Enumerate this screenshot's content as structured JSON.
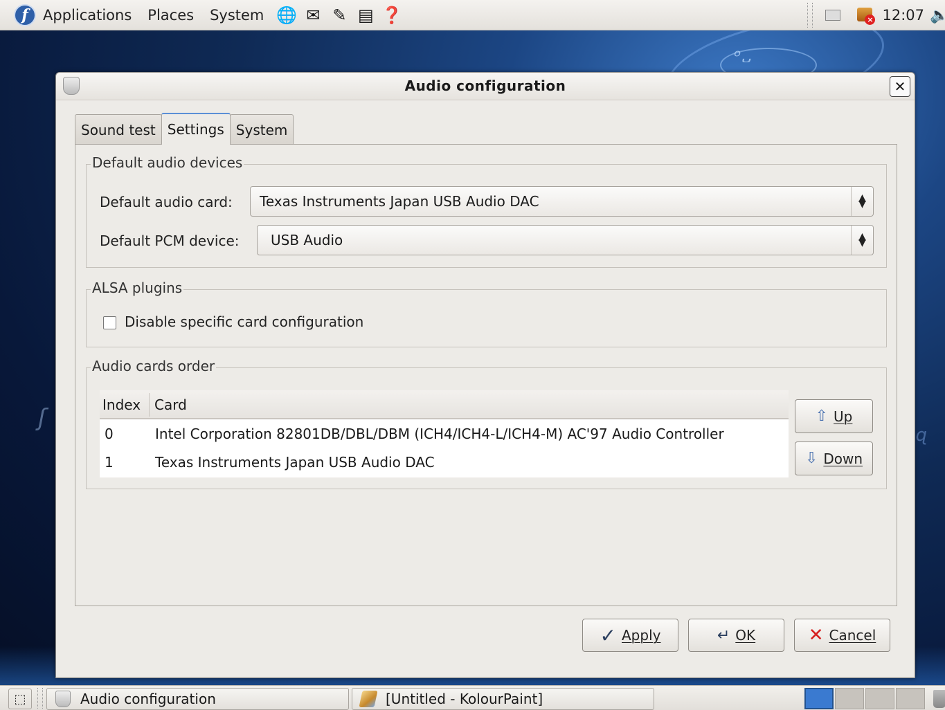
{
  "top_panel": {
    "menus": [
      "Applications",
      "Places",
      "System"
    ],
    "launcher_icons": [
      "web-browser-icon",
      "mail-client-icon",
      "text-editor-icon",
      "office-icon",
      "help-icon"
    ],
    "clock": "12:07"
  },
  "dialog": {
    "title": "Audio configuration",
    "tabs": [
      {
        "label": "Sound test",
        "active": false
      },
      {
        "label": "Settings",
        "active": true
      },
      {
        "label": "System",
        "active": false
      }
    ],
    "default_devices": {
      "legend": "Default audio devices",
      "card_label": "Default audio card:",
      "card_value": "Texas Instruments Japan USB Audio DAC",
      "pcm_label": "Default PCM device:",
      "pcm_value": "USB Audio"
    },
    "alsa_plugins": {
      "legend": "ALSA plugins",
      "checkbox_label": "Disable specific card configuration",
      "checked": false
    },
    "cards_order": {
      "legend": "Audio cards order",
      "columns": [
        "Index",
        "Card"
      ],
      "rows": [
        {
          "index": "0",
          "card": "Intel Corporation 82801DB/DBL/DBM (ICH4/ICH4-L/ICH4-M) AC'97 Audio Controller"
        },
        {
          "index": "1",
          "card": "Texas Instruments Japan USB Audio DAC"
        }
      ],
      "up_label": "Up",
      "down_label": "Down"
    },
    "buttons": {
      "apply": "Apply",
      "ok": "OK",
      "cancel": "Cancel"
    }
  },
  "taskbar": {
    "tasks": [
      {
        "label": "Audio configuration"
      },
      {
        "label": "[Untitled - KolourPaint]"
      }
    ],
    "workspaces": 4,
    "active_workspace": 1
  },
  "colors": {
    "accent_tab": "#5b8fd6",
    "desktop_blue": "#1c4684",
    "cancel_red": "#d62020"
  }
}
